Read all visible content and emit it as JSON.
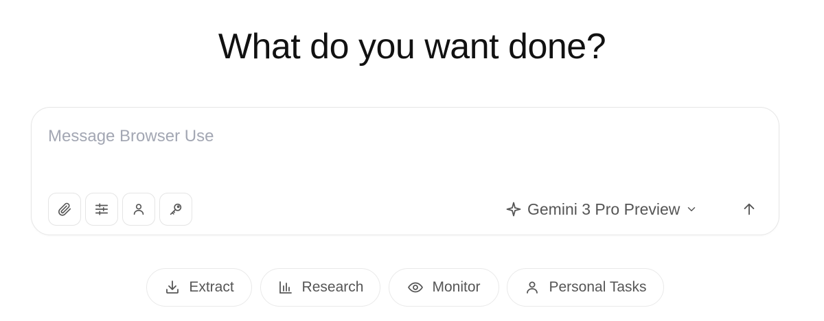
{
  "heading": "What do you want done?",
  "composer": {
    "placeholder": "Message Browser Use",
    "value": "",
    "tools": [
      {
        "name": "attach",
        "icon": "paperclip-icon"
      },
      {
        "name": "settings",
        "icon": "sliders-icon"
      },
      {
        "name": "profile",
        "icon": "user-icon"
      },
      {
        "name": "credentials",
        "icon": "key-icon"
      }
    ],
    "model": {
      "icon": "sparkle-icon",
      "label": "Gemini 3 Pro Preview",
      "dropdown_icon": "chevron-down-icon"
    },
    "send_icon": "arrow-up-icon"
  },
  "suggestions": [
    {
      "label": "Extract",
      "icon": "download-icon"
    },
    {
      "label": "Research",
      "icon": "bar-chart-icon"
    },
    {
      "label": "Monitor",
      "icon": "eye-icon"
    },
    {
      "label": "Personal Tasks",
      "icon": "user-icon"
    }
  ],
  "colors": {
    "text_primary": "#111111",
    "text_secondary": "#555555",
    "placeholder": "#a3a7b3",
    "border": "#e6e6e6",
    "background": "#ffffff"
  }
}
